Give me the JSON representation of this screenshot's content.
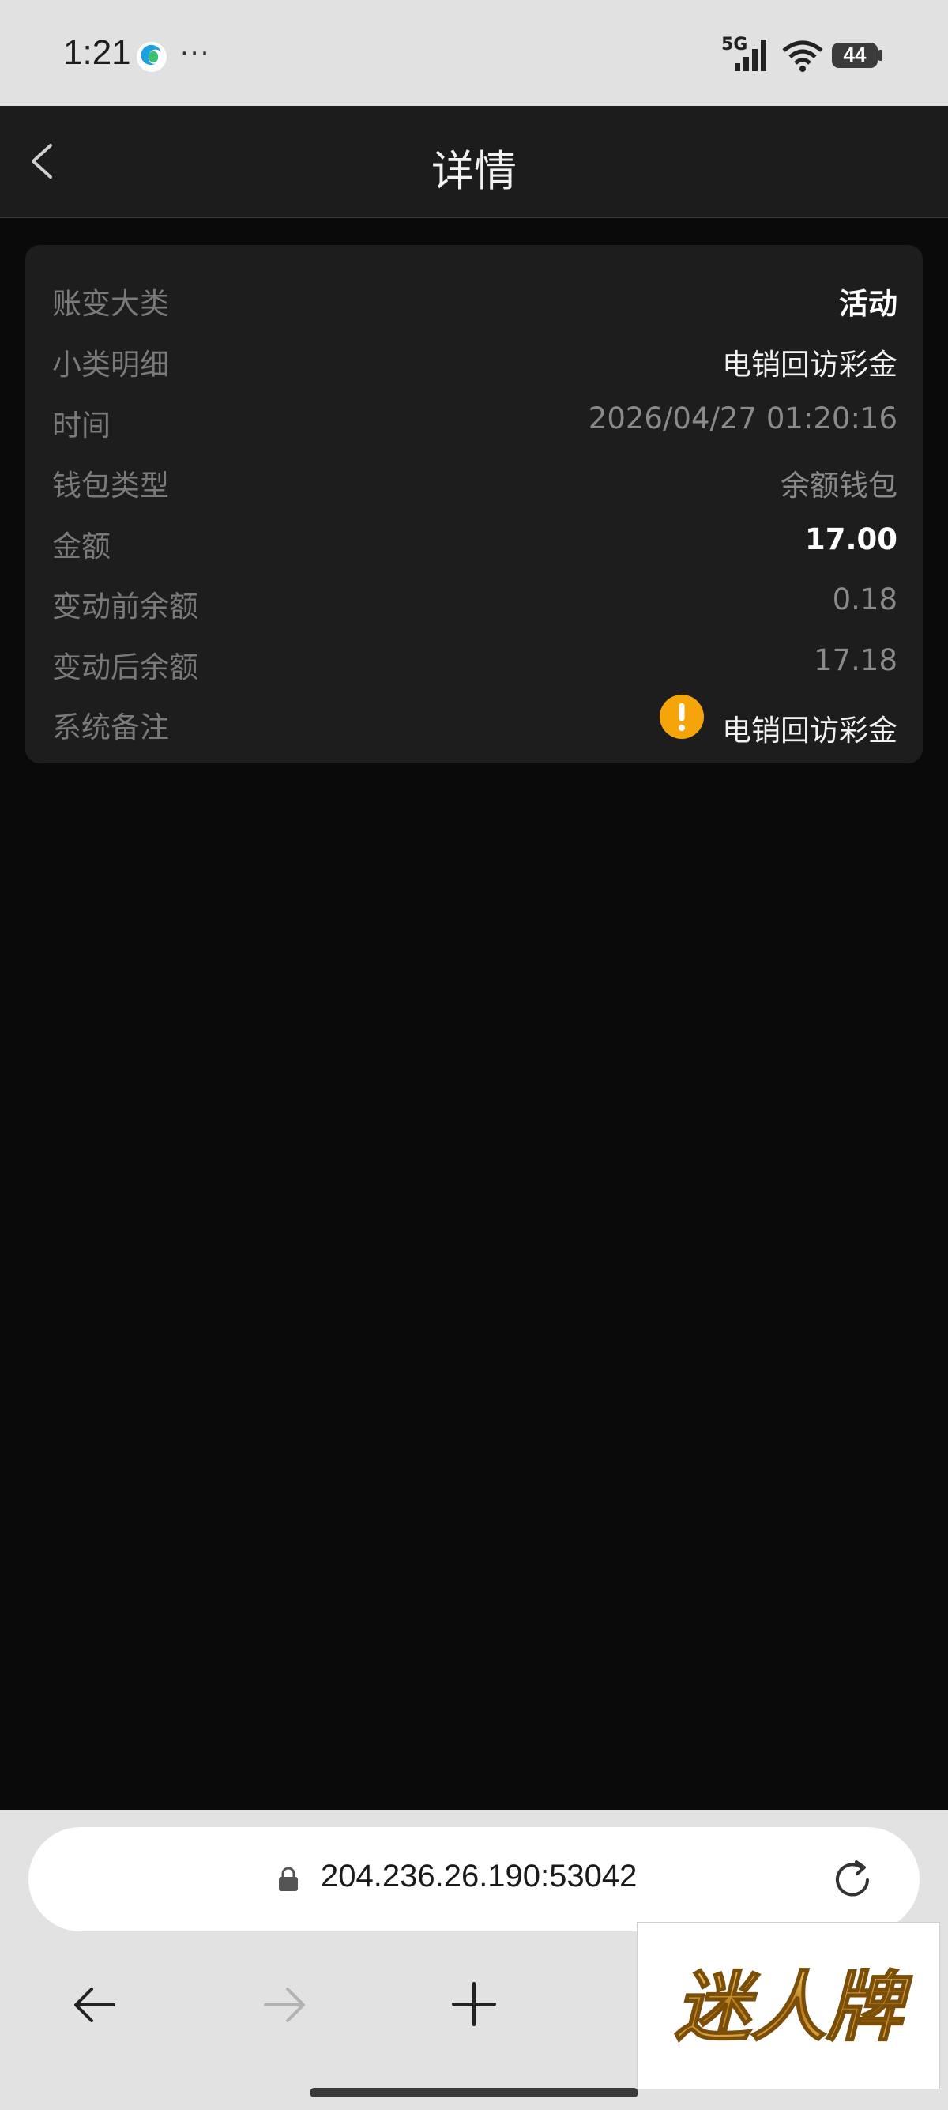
{
  "status_bar": {
    "time": "1:21",
    "more": "···",
    "network": "5G",
    "battery": "44",
    "icons": [
      "edge-browser-icon",
      "more-icon",
      "cell-signal-icon",
      "wifi-icon",
      "battery-icon"
    ]
  },
  "header": {
    "title": "详情",
    "back_icon": "chevron-left-icon"
  },
  "details": [
    {
      "label": "账变大类",
      "value": "活动"
    },
    {
      "label": "小类明细",
      "value": "电销回访彩金"
    },
    {
      "label": "时间",
      "value": "2026/04/27 01:20:16"
    },
    {
      "label": "钱包类型",
      "value": "余额钱包"
    },
    {
      "label": "金额",
      "value": "17.00"
    },
    {
      "label": "变动前余额",
      "value": "0.18"
    },
    {
      "label": "变动后余额",
      "value": "17.18"
    },
    {
      "label": "系统备注",
      "value": "电销回访彩金"
    }
  ],
  "browser": {
    "url": "204.236.26.190:53042",
    "icons": [
      "lock-icon",
      "reload-icon",
      "arrow-left-icon",
      "arrow-right-icon",
      "plus-icon"
    ]
  },
  "watermark": {
    "text": "迷人牌"
  },
  "colors": {
    "background": "#0a0a0a",
    "card": "#1d1d1d",
    "header": "#1c1c1c",
    "warning": "#f5a50a",
    "watermark_gold": "#c9962a"
  }
}
